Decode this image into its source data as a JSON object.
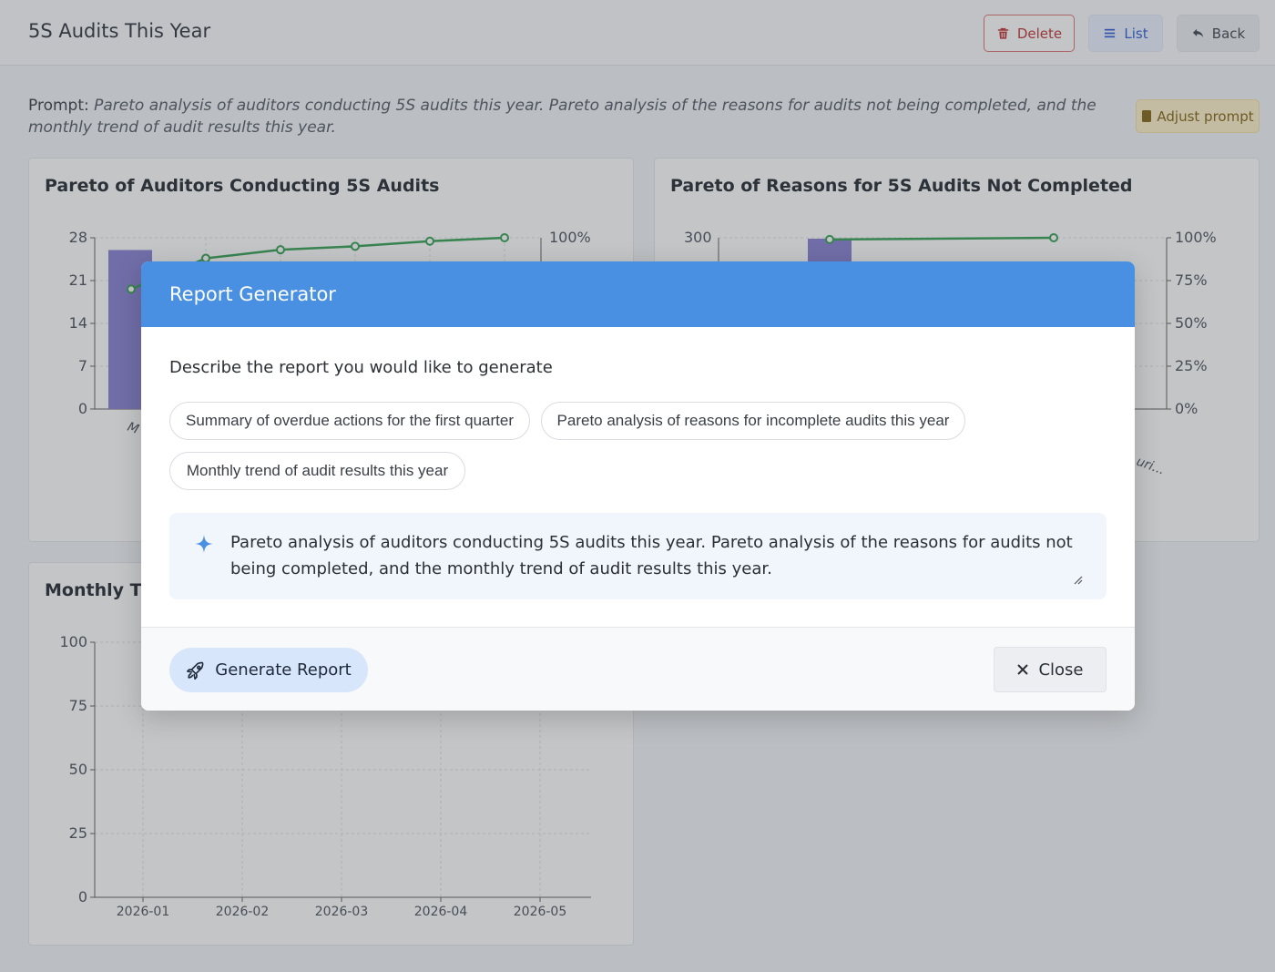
{
  "page": {
    "title": "5S Audits This Year",
    "buttons": {
      "delete": "Delete",
      "list": "List",
      "back": "Back"
    },
    "prompt_label": "Prompt:",
    "prompt_text": "Pareto analysis of auditors conducting 5S audits this year. Pareto analysis of the reasons for audits not being completed, and the monthly trend of audit results this year.",
    "adjust_prompt": "Adjust prompt"
  },
  "cards": {
    "auditors": {
      "title": "Pareto of Auditors Conducting 5S Audits"
    },
    "reasons": {
      "title": "Pareto of Reasons for 5S Audits Not Completed"
    },
    "monthly": {
      "title": "Monthly Tr"
    }
  },
  "chart_data": [
    {
      "type": "bar",
      "title": "Pareto of Auditors Conducting 5S Audits",
      "y_ticks": [
        "0",
        "7",
        "14",
        "21",
        "28"
      ],
      "y2_ticks": [
        "100%"
      ],
      "ylim": [
        0,
        28
      ],
      "x_tick_partial": "M",
      "values": [
        26
      ],
      "cumulative_pct": [
        70,
        88,
        93,
        95,
        98,
        100
      ],
      "bar_color": "#8c86d4",
      "line_color": "#3fa55b"
    },
    {
      "type": "bar",
      "title": "Pareto of Reasons for 5S Audits Not Completed",
      "y_ticks": [
        "300"
      ],
      "y2_ticks": [
        "0%",
        "25%",
        "50%",
        "75%",
        "100%"
      ],
      "x_tick_partial": "uri...",
      "cumulative_pct": [
        99,
        100
      ],
      "bar_color": "#8c86d4",
      "line_color": "#3fa55b"
    },
    {
      "type": "line",
      "title": "Monthly Tr",
      "y_ticks": [
        "0",
        "25",
        "50",
        "75",
        "100"
      ],
      "ylim": [
        0,
        100
      ],
      "x": [
        "2026-01",
        "2026-02",
        "2026-03",
        "2026-04",
        "2026-05"
      ]
    }
  ],
  "modal": {
    "title": "Report Generator",
    "heading": "Describe the report you would like to generate",
    "suggestions": [
      "Summary of overdue actions for the first quarter",
      "Pareto analysis of reasons for incomplete audits this year",
      "Monthly trend of audit results this year"
    ],
    "input_value": "Pareto analysis of auditors conducting 5S audits this year. Pareto analysis of the reasons for audits not being completed, and the monthly trend of audit results this year.",
    "generate_label": "Generate Report",
    "close_label": "Close"
  },
  "colors": {
    "accent": "#4a90e2",
    "bar": "#8c86d4",
    "line": "#3fa55b",
    "delete": "#c53d3d"
  }
}
